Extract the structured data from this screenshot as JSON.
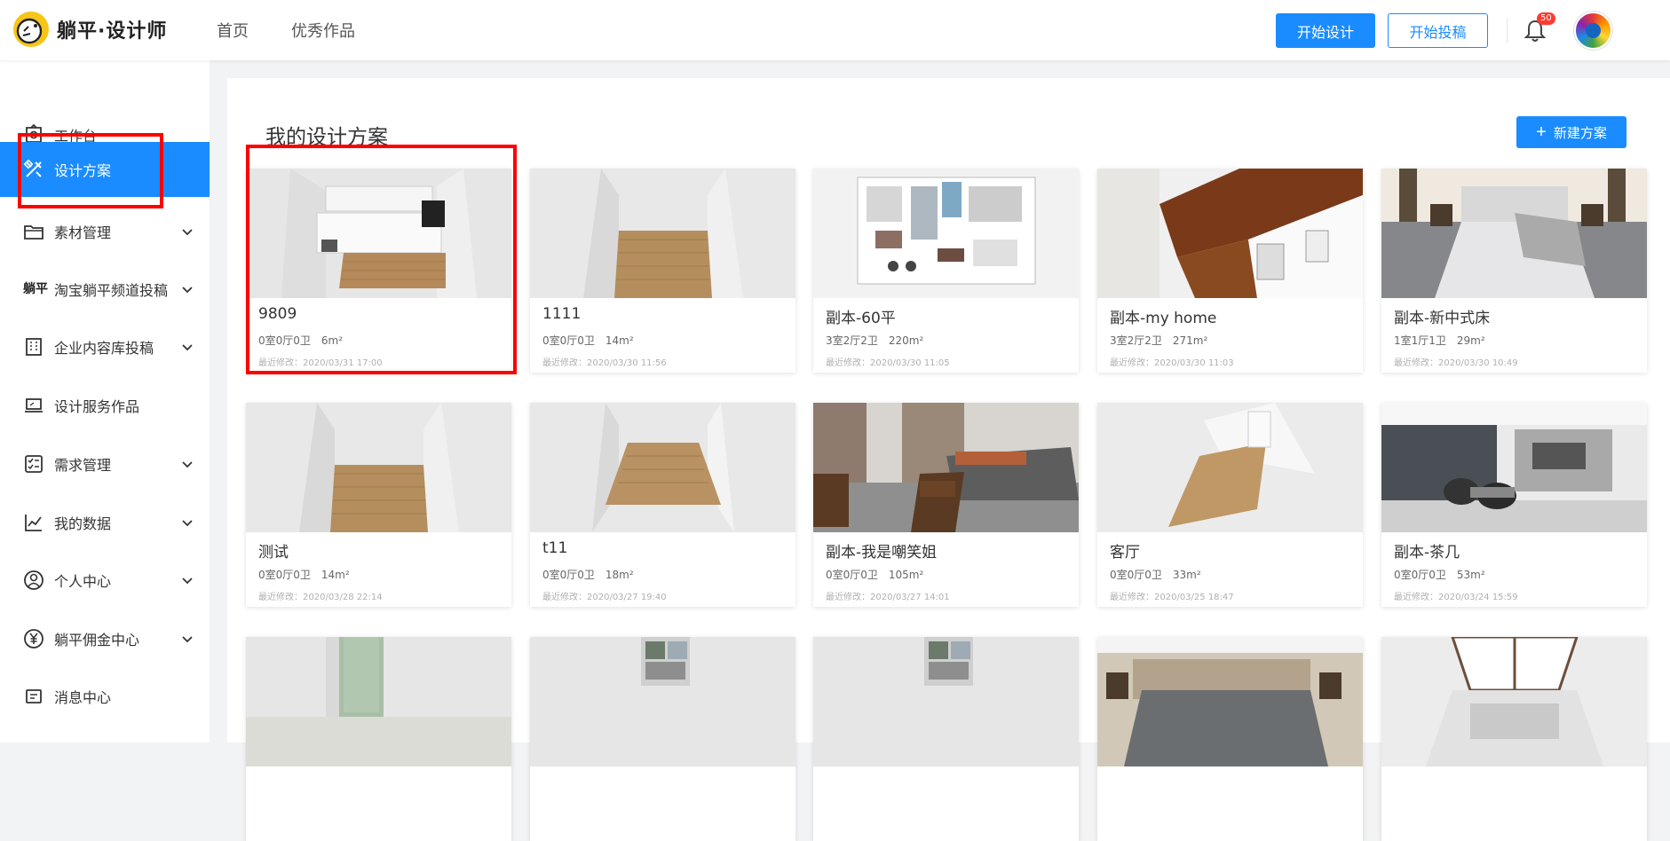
{
  "brand": {
    "name": "躺平·设计师"
  },
  "nav": {
    "home": "首页",
    "works": "优秀作品"
  },
  "header": {
    "start_design": "开始设计",
    "start_submit": "开始投稿",
    "notif_count": "50"
  },
  "sidebar": {
    "items": [
      {
        "label": "工作台",
        "icon": "workbench-icon",
        "expand": false
      },
      {
        "label": "设计方案",
        "icon": "design-plan-icon",
        "expand": false,
        "active": true
      },
      {
        "label": "素材管理",
        "icon": "folder-icon",
        "expand": true
      },
      {
        "label": "淘宝躺平频道投稿",
        "icon": "tangping-logo-icon",
        "icon_text": "躺平",
        "expand": true
      },
      {
        "label": "企业内容库投稿",
        "icon": "building-icon",
        "expand": true
      },
      {
        "label": "设计服务作品",
        "icon": "laptop-icon",
        "expand": false
      },
      {
        "label": "需求管理",
        "icon": "checklist-icon",
        "expand": true
      },
      {
        "label": "我的数据",
        "icon": "line-chart-icon",
        "expand": true
      },
      {
        "label": "个人中心",
        "icon": "user-circle-icon",
        "expand": true
      },
      {
        "label": "躺平佣金中心",
        "icon": "yen-icon",
        "expand": true
      },
      {
        "label": "消息中心",
        "icon": "message-icon",
        "expand": false
      }
    ]
  },
  "main": {
    "title": "我的设计方案",
    "new_button": "新建方案"
  },
  "cards": [
    {
      "name": "9809",
      "meta": "0室0厅0卫　6m²",
      "time": "最近修改：2020/03/31 17:00",
      "thumb": "kitchen"
    },
    {
      "name": "1111",
      "meta": "0室0厅0卫　14m²",
      "time": "最近修改：2020/03/30 11:56",
      "thumb": "room"
    },
    {
      "name": "副本-60平",
      "meta": "3室2厅2卫　220m²",
      "time": "最近修改：2020/03/30 11:05",
      "thumb": "floorplan"
    },
    {
      "name": "副本-my home",
      "meta": "3室2厅2卫　271m²",
      "time": "最近修改：2020/03/30 11:03",
      "thumb": "wood"
    },
    {
      "name": "副本-新中式床",
      "meta": "1室1厅1卫　29m²",
      "time": "最近修改：2020/03/30 10:49",
      "thumb": "bedroom"
    },
    {
      "name": "测试",
      "meta": "0室0厅0卫　14m²",
      "time": "最近修改：2020/03/28 22:14",
      "thumb": "room"
    },
    {
      "name": "t11",
      "meta": "0室0厅0卫　18m²",
      "time": "最近修改：2020/03/27 19:40",
      "thumb": "room2"
    },
    {
      "name": "副本-我是嘲笑姐",
      "meta": "0室0厅0卫　105m²",
      "time": "最近修改：2020/03/27 14:01",
      "thumb": "living"
    },
    {
      "name": "客厅",
      "meta": "0室0厅0卫　33m²",
      "time": "最近修改：2020/03/25 18:47",
      "thumb": "room3"
    },
    {
      "name": "副本-茶几",
      "meta": "0室0厅0卫　53m²",
      "time": "最近修改：2020/03/24 15:59",
      "thumb": "lounge"
    },
    {
      "name": "",
      "meta": "",
      "time": "",
      "thumb": "door"
    },
    {
      "name": "",
      "meta": "",
      "time": "",
      "thumb": "mini"
    },
    {
      "name": "",
      "meta": "",
      "time": "",
      "thumb": "mini"
    },
    {
      "name": "",
      "meta": "",
      "time": "",
      "thumb": "bedroom2"
    },
    {
      "name": "",
      "meta": "",
      "time": "",
      "thumb": "window"
    }
  ],
  "colors": {
    "primary": "#1a8cff",
    "highlight": "#ff0000"
  }
}
